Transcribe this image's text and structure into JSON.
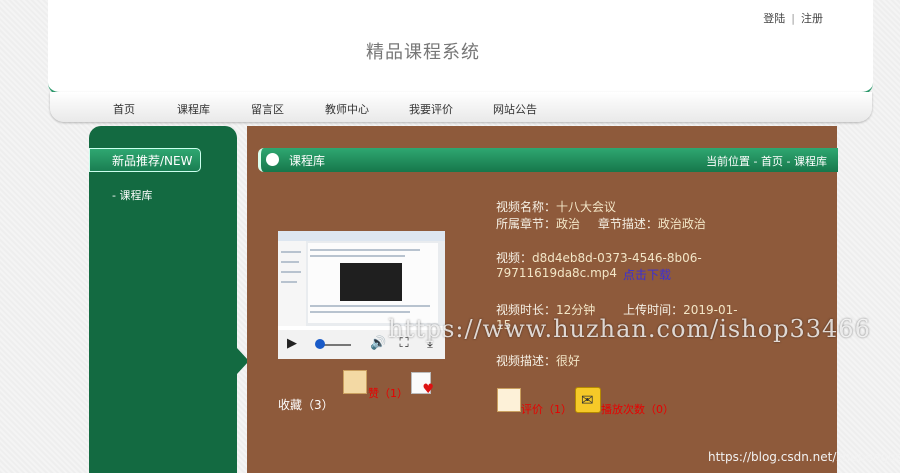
{
  "header": {
    "site_title": "精品课程系统",
    "login": "登陆",
    "register": "注册"
  },
  "nav": {
    "items": [
      "首页",
      "课程库",
      "留言区",
      "教师中心",
      "我要评价",
      "网站公告"
    ]
  },
  "sidebar": {
    "title": "新品推荐/NEW",
    "link": "- 课程库"
  },
  "panel": {
    "title": "课程库",
    "breadcrumb": "当前位置 - 首页 - 课程库"
  },
  "video": {
    "name_label": "视频名称：",
    "name": "十八大会议",
    "chapter_label": "所属章节：",
    "chapter": "政治",
    "chapter_desc_label": "章节描述：",
    "chapter_desc": "政治政治",
    "file_label": "视频：",
    "file_line1": "d8d4eb8d-0373-4546-8b06-",
    "file_line2": "79711619da8c.mp4",
    "download": "点击下载",
    "duration_label": "视频时长：",
    "duration": "12分钟",
    "upload_label": "上传时间：",
    "upload_time": "2019-01-",
    "upload_time_rest": "15",
    "desc_label": "视频描述：",
    "desc": "很好"
  },
  "actions": {
    "favorite": "收藏（3）",
    "like": "赞（1）",
    "comment": "评价（1）",
    "plays": "播放次数（0）"
  },
  "watermarks": {
    "main": "https://www.huzhan.com/ishop33466",
    "corner": "https://blog.csdn.net/zhupengqq"
  },
  "colors": {
    "green": "#136a41",
    "brown": "#8e5a3b",
    "accent": "#2e9b6e"
  }
}
